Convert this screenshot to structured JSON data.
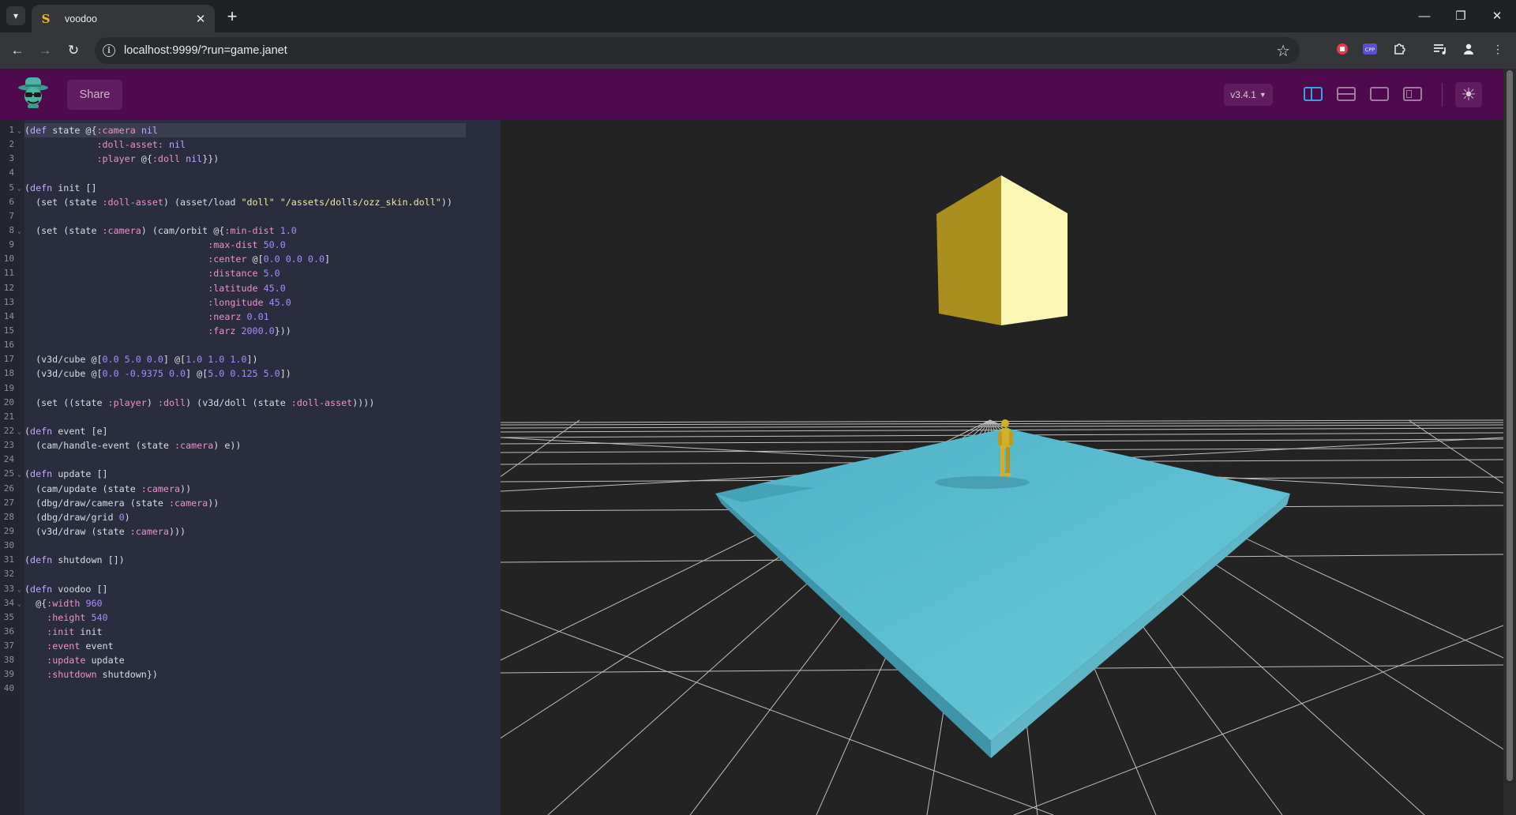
{
  "browser": {
    "tab_title": "voodoo",
    "tab_favicon": "S",
    "url": "localhost:9999/?run=game.janet"
  },
  "icons": {
    "tab_menu": "chevron-down-icon",
    "close": "close-icon",
    "new_tab": "plus-icon",
    "back": "arrow-left-icon",
    "forward": "arrow-right-icon",
    "reload": "reload-icon",
    "info": "info-icon",
    "bookmark": "star-icon",
    "theme": "sun-icon"
  },
  "app": {
    "share_label": "Share",
    "version_label": "v3.4.1"
  },
  "colors": {
    "header": "#4f0a4e",
    "editor_bg": "#2a2d3e",
    "viewport_bg": "#232323",
    "active_layout": "#3da0e6",
    "cube": "#b39a24",
    "slab": "#5bbccf",
    "doll": "#d4af2a"
  },
  "editor": {
    "lines": [
      {
        "n": "1",
        "fold": true,
        "active": true,
        "seg": [
          [
            "p",
            "("
          ],
          [
            "k",
            "def"
          ],
          [
            "p",
            " state @{"
          ],
          [
            "pk",
            ":camera"
          ],
          [
            "p",
            " "
          ],
          [
            "k",
            "nil"
          ]
        ]
      },
      {
        "n": "2",
        "seg": [
          [
            "p",
            "             "
          ],
          [
            "pk",
            ":doll-asset:"
          ],
          [
            "p",
            " "
          ],
          [
            "k",
            "nil"
          ]
        ]
      },
      {
        "n": "3",
        "seg": [
          [
            "p",
            "             "
          ],
          [
            "pk",
            ":player"
          ],
          [
            "p",
            " @{"
          ],
          [
            "pk",
            ":doll"
          ],
          [
            "p",
            " "
          ],
          [
            "k",
            "nil"
          ],
          [
            "p",
            "}})"
          ]
        ]
      },
      {
        "n": "4",
        "seg": []
      },
      {
        "n": "5",
        "fold": true,
        "seg": [
          [
            "p",
            "("
          ],
          [
            "k",
            "defn"
          ],
          [
            "p",
            " init []"
          ]
        ]
      },
      {
        "n": "6",
        "seg": [
          [
            "p",
            "  (set (state "
          ],
          [
            "pk",
            ":doll-asset"
          ],
          [
            "p",
            ") (asset/load "
          ],
          [
            "s",
            "\"doll\""
          ],
          [
            "p",
            " "
          ],
          [
            "s",
            "\"/assets/dolls/ozz_skin.doll\""
          ],
          [
            "p",
            "))"
          ]
        ]
      },
      {
        "n": "7",
        "seg": []
      },
      {
        "n": "8",
        "fold": true,
        "seg": [
          [
            "p",
            "  (set (state "
          ],
          [
            "pk",
            ":camera"
          ],
          [
            "p",
            ") (cam/orbit @{"
          ],
          [
            "pk",
            ":min-dist"
          ],
          [
            "p",
            " "
          ],
          [
            "n",
            "1.0"
          ]
        ]
      },
      {
        "n": "9",
        "seg": [
          [
            "p",
            "                                 "
          ],
          [
            "pk",
            ":max-dist"
          ],
          [
            "p",
            " "
          ],
          [
            "n",
            "50.0"
          ]
        ]
      },
      {
        "n": "10",
        "seg": [
          [
            "p",
            "                                 "
          ],
          [
            "pk",
            ":center"
          ],
          [
            "p",
            " @["
          ],
          [
            "n",
            "0.0 0.0 0.0"
          ],
          [
            "p",
            "]"
          ]
        ]
      },
      {
        "n": "11",
        "seg": [
          [
            "p",
            "                                 "
          ],
          [
            "pk",
            ":distance"
          ],
          [
            "p",
            " "
          ],
          [
            "n",
            "5.0"
          ]
        ]
      },
      {
        "n": "12",
        "seg": [
          [
            "p",
            "                                 "
          ],
          [
            "pk",
            ":latitude"
          ],
          [
            "p",
            " "
          ],
          [
            "n",
            "45.0"
          ]
        ]
      },
      {
        "n": "13",
        "seg": [
          [
            "p",
            "                                 "
          ],
          [
            "pk",
            ":longitude"
          ],
          [
            "p",
            " "
          ],
          [
            "n",
            "45.0"
          ]
        ]
      },
      {
        "n": "14",
        "seg": [
          [
            "p",
            "                                 "
          ],
          [
            "pk",
            ":nearz"
          ],
          [
            "p",
            " "
          ],
          [
            "n",
            "0.01"
          ]
        ]
      },
      {
        "n": "15",
        "seg": [
          [
            "p",
            "                                 "
          ],
          [
            "pk",
            ":farz"
          ],
          [
            "p",
            " "
          ],
          [
            "n",
            "2000.0"
          ],
          [
            "p",
            "}))"
          ]
        ]
      },
      {
        "n": "16",
        "seg": []
      },
      {
        "n": "17",
        "seg": [
          [
            "p",
            "  (v3d/cube @["
          ],
          [
            "n",
            "0.0 5.0 0.0"
          ],
          [
            "p",
            "] @["
          ],
          [
            "n",
            "1.0 1.0 1.0"
          ],
          [
            "p",
            "])"
          ]
        ]
      },
      {
        "n": "18",
        "seg": [
          [
            "p",
            "  (v3d/cube @["
          ],
          [
            "n",
            "0.0 -0.9375 0.0"
          ],
          [
            "p",
            "] @["
          ],
          [
            "n",
            "5.0 0.125 5.0"
          ],
          [
            "p",
            "])"
          ]
        ]
      },
      {
        "n": "19",
        "seg": []
      },
      {
        "n": "20",
        "seg": [
          [
            "p",
            "  (set ((state "
          ],
          [
            "pk",
            ":player"
          ],
          [
            "p",
            ") "
          ],
          [
            "pk",
            ":doll"
          ],
          [
            "p",
            ") (v3d/doll (state "
          ],
          [
            "pk",
            ":doll-asset"
          ],
          [
            "p",
            "))))"
          ]
        ]
      },
      {
        "n": "21",
        "seg": []
      },
      {
        "n": "22",
        "fold": true,
        "seg": [
          [
            "p",
            "("
          ],
          [
            "k",
            "defn"
          ],
          [
            "p",
            " event [e]"
          ]
        ]
      },
      {
        "n": "23",
        "seg": [
          [
            "p",
            "  (cam/handle-event (state "
          ],
          [
            "pk",
            ":camera"
          ],
          [
            "p",
            ") e))"
          ]
        ]
      },
      {
        "n": "24",
        "seg": []
      },
      {
        "n": "25",
        "fold": true,
        "seg": [
          [
            "p",
            "("
          ],
          [
            "k",
            "defn"
          ],
          [
            "p",
            " update []"
          ]
        ]
      },
      {
        "n": "26",
        "seg": [
          [
            "p",
            "  (cam/update (state "
          ],
          [
            "pk",
            ":camera"
          ],
          [
            "p",
            "))"
          ]
        ]
      },
      {
        "n": "27",
        "seg": [
          [
            "p",
            "  (dbg/draw/camera (state "
          ],
          [
            "pk",
            ":camera"
          ],
          [
            "p",
            "))"
          ]
        ]
      },
      {
        "n": "28",
        "seg": [
          [
            "p",
            "  (dbg/draw/grid "
          ],
          [
            "n",
            "0"
          ],
          [
            "p",
            ")"
          ]
        ]
      },
      {
        "n": "29",
        "seg": [
          [
            "p",
            "  (v3d/draw (state "
          ],
          [
            "pk",
            ":camera"
          ],
          [
            "p",
            ")))"
          ]
        ]
      },
      {
        "n": "30",
        "seg": []
      },
      {
        "n": "31",
        "seg": [
          [
            "p",
            "("
          ],
          [
            "k",
            "defn"
          ],
          [
            "p",
            " shutdown [])"
          ]
        ]
      },
      {
        "n": "32",
        "seg": []
      },
      {
        "n": "33",
        "fold": true,
        "seg": [
          [
            "p",
            "("
          ],
          [
            "k",
            "defn"
          ],
          [
            "p",
            " voodoo []"
          ]
        ]
      },
      {
        "n": "34",
        "fold": true,
        "seg": [
          [
            "p",
            "  @{"
          ],
          [
            "pk",
            ":width"
          ],
          [
            "p",
            " "
          ],
          [
            "n",
            "960"
          ]
        ]
      },
      {
        "n": "35",
        "seg": [
          [
            "p",
            "    "
          ],
          [
            "pk",
            ":height"
          ],
          [
            "p",
            " "
          ],
          [
            "n",
            "540"
          ]
        ]
      },
      {
        "n": "36",
        "seg": [
          [
            "p",
            "    "
          ],
          [
            "pk",
            ":init"
          ],
          [
            "p",
            " init"
          ]
        ]
      },
      {
        "n": "37",
        "seg": [
          [
            "p",
            "    "
          ],
          [
            "pk",
            ":event"
          ],
          [
            "p",
            " event"
          ]
        ]
      },
      {
        "n": "38",
        "seg": [
          [
            "p",
            "    "
          ],
          [
            "pk",
            ":update"
          ],
          [
            "p",
            " update"
          ]
        ]
      },
      {
        "n": "39",
        "seg": [
          [
            "p",
            "    "
          ],
          [
            "pk",
            ":shutdown"
          ],
          [
            "p",
            " shutdown})"
          ]
        ]
      },
      {
        "n": "40",
        "seg": []
      }
    ]
  }
}
